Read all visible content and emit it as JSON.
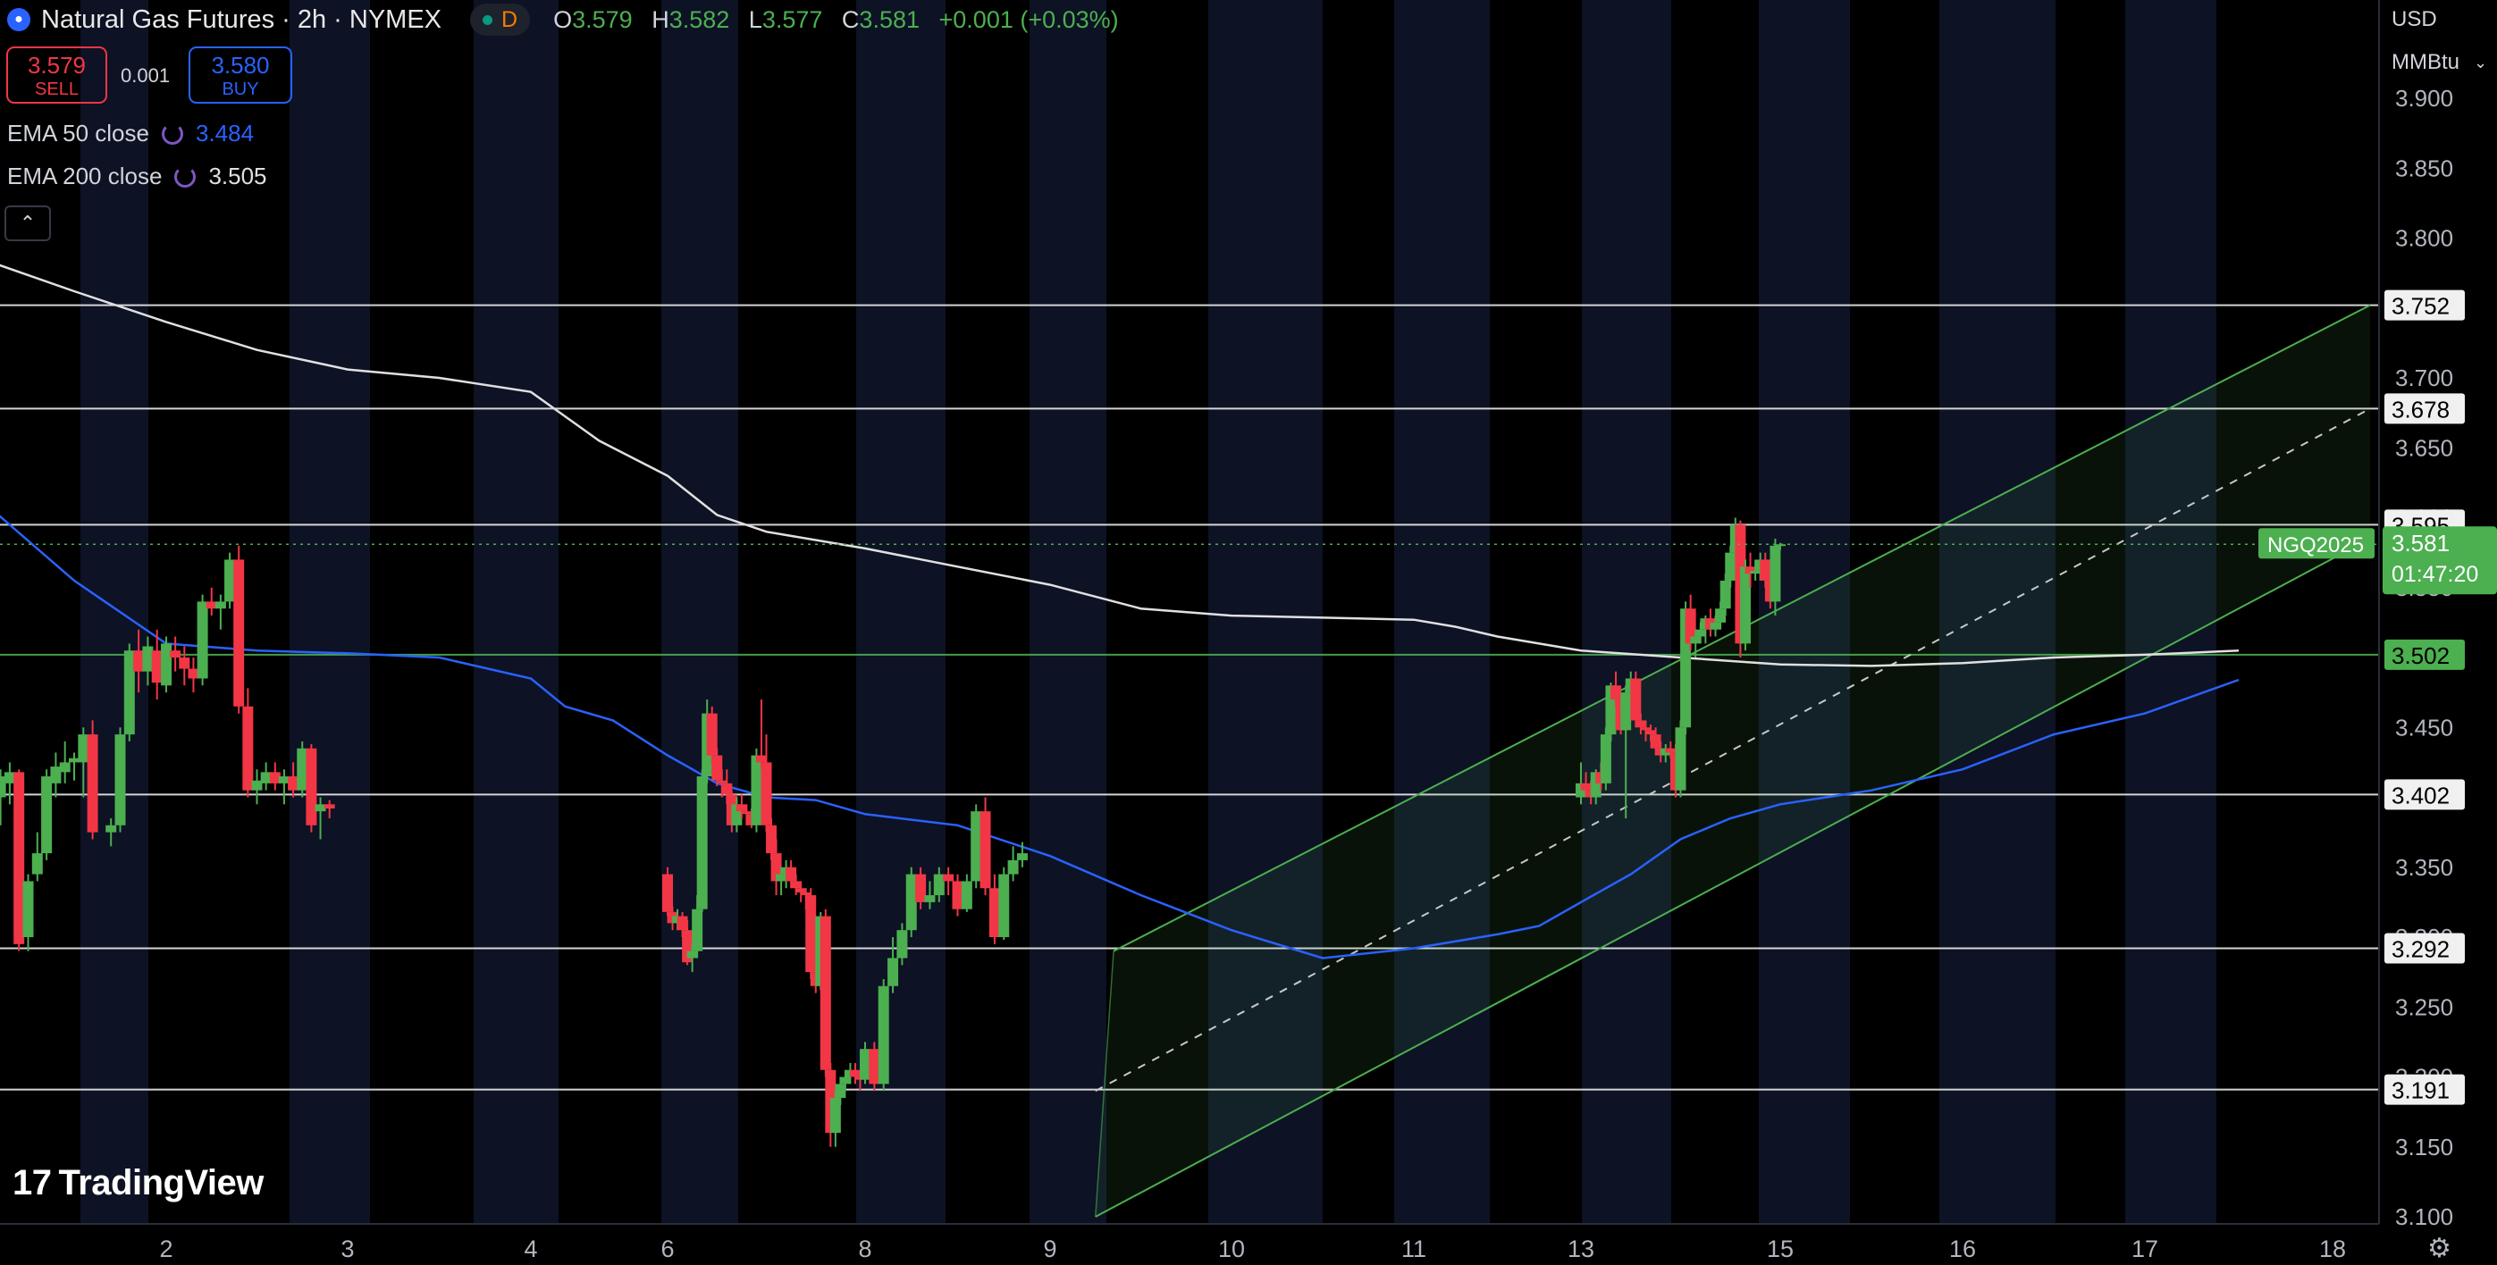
{
  "header": {
    "title": "Natural Gas Futures · 2h · NYMEX",
    "badge_letter": "D",
    "ohlc": {
      "o_label": "O",
      "o": "3.579",
      "h_label": "H",
      "h": "3.582",
      "l_label": "L",
      "l": "3.577",
      "c_label": "C",
      "c": "3.581",
      "change": "+0.001 (+0.03%)"
    }
  },
  "trade": {
    "sell_price": "3.579",
    "sell_label": "SELL",
    "spread": "0.001",
    "buy_price": "3.580",
    "buy_label": "BUY"
  },
  "indicators": [
    {
      "label": "EMA 50 close",
      "value": "3.484",
      "color": "#2962ff"
    },
    {
      "label": "EMA 200 close",
      "value": "3.505",
      "color": "#e0e0e0"
    }
  ],
  "price_axis": {
    "currency": "USD",
    "unit": "MMBtu",
    "ticks": [
      "3.900",
      "3.850",
      "3.800",
      "3.750",
      "3.700",
      "3.650",
      "3.600",
      "3.550",
      "3.500",
      "3.450",
      "3.400",
      "3.350",
      "3.300",
      "3.250",
      "3.200",
      "3.150",
      "3.100"
    ]
  },
  "time_axis": {
    "labels": [
      {
        "label": "2",
        "x": 2
      },
      {
        "label": "3",
        "x": 3
      },
      {
        "label": "4",
        "x": 4
      },
      {
        "label": "6",
        "x": 6
      },
      {
        "label": "8",
        "x": 8
      },
      {
        "label": "9",
        "x": 9
      },
      {
        "label": "10",
        "x": 10
      },
      {
        "label": "11",
        "x": 11
      },
      {
        "label": "13",
        "x": 13
      },
      {
        "label": "15",
        "x": 15
      },
      {
        "label": "16",
        "x": 16
      },
      {
        "label": "17",
        "x": 17
      },
      {
        "label": "18",
        "x": 18
      }
    ]
  },
  "current_price": {
    "symbol": "NGQ2025",
    "price": "3.581",
    "countdown": "01:47:20"
  },
  "brand": {
    "logo_text": "TradingView"
  },
  "colors": {
    "up": "#4caf50",
    "down": "#f23645",
    "ema50": "#2962ff",
    "ema200": "#e0e0e0",
    "channel": "#4caf50",
    "level": "#e0e0e0"
  },
  "chart_data": {
    "type": "candlestick",
    "ylim": [
      3.1,
      3.9
    ],
    "horizontal_levels": [
      {
        "value": 3.752,
        "label": "3.752"
      },
      {
        "value": 3.678,
        "label": "3.678"
      },
      {
        "value": 3.595,
        "label": "3.595"
      },
      {
        "value": 3.502,
        "label": "3.502",
        "highlight": true
      },
      {
        "value": 3.402,
        "label": "3.402"
      },
      {
        "value": 3.292,
        "label": "3.292"
      },
      {
        "value": 3.191,
        "label": "3.191"
      }
    ],
    "channel": {
      "upper": [
        [
          9.35,
          3.29
        ],
        [
          18.2,
          3.752
        ]
      ],
      "middle": [
        [
          9.25,
          3.19
        ],
        [
          18.2,
          3.678
        ]
      ],
      "lower": [
        [
          9.25,
          3.1
        ],
        [
          18.2,
          3.585
        ]
      ]
    },
    "ema50": [
      [
        1.0,
        3.612
      ],
      [
        1.5,
        3.555
      ],
      [
        2.0,
        3.51
      ],
      [
        2.5,
        3.505
      ],
      [
        3.0,
        3.503
      ],
      [
        3.5,
        3.5
      ],
      [
        4.0,
        3.485
      ],
      [
        4.5,
        3.465
      ],
      [
        5.2,
        3.455
      ],
      [
        6.0,
        3.43
      ],
      [
        6.5,
        3.41
      ],
      [
        7.0,
        3.4
      ],
      [
        7.5,
        3.398
      ],
      [
        8.0,
        3.388
      ],
      [
        8.5,
        3.38
      ],
      [
        9.0,
        3.358
      ],
      [
        9.5,
        3.33
      ],
      [
        10.0,
        3.305
      ],
      [
        10.5,
        3.285
      ],
      [
        11.0,
        3.292
      ],
      [
        12.0,
        3.302
      ],
      [
        12.5,
        3.308
      ],
      [
        13.0,
        3.325
      ],
      [
        13.5,
        3.345
      ],
      [
        14.0,
        3.37
      ],
      [
        14.5,
        3.385
      ],
      [
        15.0,
        3.395
      ],
      [
        15.5,
        3.405
      ],
      [
        16.0,
        3.42
      ],
      [
        16.5,
        3.445
      ],
      [
        17.0,
        3.46
      ],
      [
        17.5,
        3.484
      ]
    ],
    "ema200": [
      [
        1.0,
        3.785
      ],
      [
        1.5,
        3.762
      ],
      [
        2.0,
        3.74
      ],
      [
        2.5,
        3.72
      ],
      [
        3.0,
        3.706
      ],
      [
        3.5,
        3.7
      ],
      [
        4.0,
        3.69
      ],
      [
        5.0,
        3.655
      ],
      [
        6.0,
        3.63
      ],
      [
        6.5,
        3.602
      ],
      [
        7.0,
        3.59
      ],
      [
        8.0,
        3.578
      ],
      [
        8.5,
        3.565
      ],
      [
        9.0,
        3.552
      ],
      [
        9.5,
        3.535
      ],
      [
        10.0,
        3.53
      ],
      [
        11.0,
        3.527
      ],
      [
        11.5,
        3.522
      ],
      [
        12.0,
        3.515
      ],
      [
        12.5,
        3.51
      ],
      [
        13.0,
        3.505
      ],
      [
        14.0,
        3.5
      ],
      [
        15.0,
        3.495
      ],
      [
        15.5,
        3.494
      ],
      [
        16.0,
        3.496
      ],
      [
        16.5,
        3.5
      ],
      [
        17.0,
        3.502
      ],
      [
        17.5,
        3.505
      ]
    ],
    "candles": [
      [
        1.0,
        3.455,
        3.46,
        3.44,
        3.442
      ],
      [
        1.05,
        3.44,
        3.448,
        3.39,
        3.395
      ],
      [
        1.1,
        3.4,
        3.42,
        3.38,
        3.415
      ],
      [
        1.15,
        3.41,
        3.425,
        3.395,
        3.418
      ],
      [
        1.2,
        3.418,
        3.42,
        3.29,
        3.295
      ],
      [
        1.25,
        3.3,
        3.345,
        3.29,
        3.34
      ],
      [
        1.3,
        3.345,
        3.375,
        3.34,
        3.36
      ],
      [
        1.35,
        3.36,
        3.42,
        3.355,
        3.415
      ],
      [
        1.4,
        3.41,
        3.432,
        3.4,
        3.422
      ],
      [
        1.45,
        3.418,
        3.44,
        3.41,
        3.425
      ],
      [
        1.5,
        3.425,
        3.432,
        3.412,
        3.428
      ],
      [
        1.55,
        3.425,
        3.45,
        3.4,
        3.445
      ],
      [
        1.6,
        3.445,
        3.455,
        3.37,
        3.375
      ],
      [
        1.7,
        3.375,
        3.385,
        3.365,
        3.38
      ],
      [
        1.75,
        3.38,
        3.45,
        3.375,
        3.445
      ],
      [
        1.8,
        3.445,
        3.51,
        3.44,
        3.505
      ],
      [
        1.85,
        3.505,
        3.52,
        3.475,
        3.49
      ],
      [
        1.9,
        3.49,
        3.515,
        3.48,
        3.508
      ],
      [
        1.95,
        3.505,
        3.52,
        3.47,
        3.482
      ],
      [
        2.0,
        3.48,
        3.515,
        3.475,
        3.51
      ],
      [
        2.05,
        3.505,
        3.515,
        3.49,
        3.5
      ],
      [
        2.1,
        3.5,
        3.508,
        3.48,
        3.492
      ],
      [
        2.15,
        3.492,
        3.5,
        3.475,
        3.485
      ],
      [
        2.2,
        3.485,
        3.545,
        3.48,
        3.54
      ],
      [
        2.25,
        3.54,
        3.55,
        3.53,
        3.535
      ],
      [
        2.3,
        3.535,
        3.545,
        3.52,
        3.54
      ],
      [
        2.35,
        3.54,
        3.575,
        3.535,
        3.57
      ],
      [
        2.4,
        3.57,
        3.58,
        3.46,
        3.465
      ],
      [
        2.45,
        3.465,
        3.478,
        3.4,
        3.405
      ],
      [
        2.5,
        3.405,
        3.42,
        3.395,
        3.412
      ],
      [
        2.55,
        3.41,
        3.425,
        3.405,
        3.418
      ],
      [
        2.6,
        3.418,
        3.425,
        3.405,
        3.41
      ],
      [
        2.65,
        3.41,
        3.42,
        3.395,
        3.415
      ],
      [
        2.7,
        3.415,
        3.425,
        3.4,
        3.405
      ],
      [
        2.75,
        3.405,
        3.44,
        3.4,
        3.435
      ],
      [
        2.8,
        3.435,
        3.438,
        3.375,
        3.38
      ],
      [
        2.85,
        3.39,
        3.4,
        3.37,
        3.395
      ],
      [
        2.9,
        3.395,
        3.398,
        3.385,
        3.392
      ],
      [
        6.0,
        3.345,
        3.35,
        3.315,
        3.318
      ],
      [
        6.05,
        3.318,
        3.322,
        3.305,
        3.31
      ],
      [
        6.1,
        3.31,
        3.32,
        3.305,
        3.315
      ],
      [
        6.15,
        3.315,
        3.318,
        3.3,
        3.305
      ],
      [
        6.2,
        3.305,
        3.312,
        3.28,
        3.282
      ],
      [
        6.25,
        3.285,
        3.295,
        3.275,
        3.29
      ],
      [
        6.3,
        3.29,
        3.33,
        3.285,
        3.32
      ],
      [
        6.35,
        3.32,
        3.42,
        3.318,
        3.415
      ],
      [
        6.4,
        3.415,
        3.47,
        3.41,
        3.46
      ],
      [
        6.45,
        3.46,
        3.465,
        3.425,
        3.43
      ],
      [
        6.5,
        3.43,
        3.435,
        3.408,
        3.412
      ],
      [
        6.55,
        3.412,
        3.42,
        3.4,
        3.41
      ],
      [
        6.6,
        3.41,
        3.42,
        3.395,
        3.402
      ],
      [
        6.65,
        3.402,
        3.405,
        3.375,
        3.38
      ],
      [
        6.7,
        3.38,
        3.4,
        3.375,
        3.395
      ],
      [
        6.75,
        3.395,
        3.402,
        3.385,
        3.39
      ],
      [
        6.8,
        3.39,
        3.395,
        3.38,
        3.388
      ],
      [
        6.85,
        3.388,
        3.392,
        3.378,
        3.38
      ],
      [
        6.9,
        3.38,
        3.435,
        3.375,
        3.43
      ],
      [
        6.95,
        3.43,
        3.47,
        3.42,
        3.425
      ],
      [
        7.0,
        3.425,
        3.445,
        3.375,
        3.38
      ],
      [
        7.05,
        3.38,
        3.385,
        3.355,
        3.36
      ],
      [
        7.1,
        3.36,
        3.37,
        3.33,
        3.34
      ],
      [
        7.15,
        3.34,
        3.35,
        3.33,
        3.345
      ],
      [
        7.2,
        3.345,
        3.355,
        3.335,
        3.35
      ],
      [
        7.25,
        3.35,
        3.355,
        3.335,
        3.34
      ],
      [
        7.3,
        3.34,
        3.345,
        3.33,
        3.335
      ],
      [
        7.35,
        3.335,
        3.34,
        3.325,
        3.332
      ],
      [
        7.4,
        3.332,
        3.335,
        3.32,
        3.33
      ],
      [
        7.45,
        3.33,
        3.335,
        3.27,
        3.275
      ],
      [
        7.5,
        3.275,
        3.28,
        3.26,
        3.265
      ],
      [
        7.55,
        3.265,
        3.318,
        3.262,
        3.315
      ],
      [
        7.6,
        3.315,
        3.32,
        3.2,
        3.205
      ],
      [
        7.65,
        3.205,
        3.21,
        3.15,
        3.16
      ],
      [
        7.7,
        3.16,
        3.19,
        3.15,
        3.185
      ],
      [
        7.75,
        3.185,
        3.2,
        3.18,
        3.195
      ],
      [
        7.8,
        3.195,
        3.205,
        3.19,
        3.2
      ],
      [
        7.85,
        3.2,
        3.21,
        3.195,
        3.205
      ],
      [
        7.9,
        3.205,
        3.21,
        3.195,
        3.2
      ],
      [
        7.95,
        3.2,
        3.205,
        3.19,
        3.198
      ],
      [
        8.0,
        3.198,
        3.225,
        3.195,
        3.22
      ],
      [
        8.05,
        3.22,
        3.225,
        3.19,
        3.195
      ],
      [
        8.1,
        3.195,
        3.27,
        3.19,
        3.265
      ],
      [
        8.15,
        3.265,
        3.3,
        3.26,
        3.285
      ],
      [
        8.2,
        3.285,
        3.31,
        3.28,
        3.305
      ],
      [
        8.25,
        3.305,
        3.35,
        3.3,
        3.345
      ],
      [
        8.3,
        3.345,
        3.35,
        3.32,
        3.325
      ],
      [
        8.35,
        3.325,
        3.34,
        3.32,
        3.33
      ],
      [
        8.4,
        3.33,
        3.35,
        3.325,
        3.345
      ],
      [
        8.45,
        3.345,
        3.35,
        3.33,
        3.34
      ],
      [
        8.5,
        3.34,
        3.345,
        3.315,
        3.32
      ],
      [
        8.55,
        3.32,
        3.345,
        3.318,
        3.34
      ],
      [
        8.6,
        3.34,
        3.395,
        3.335,
        3.39
      ],
      [
        8.65,
        3.39,
        3.4,
        3.33,
        3.335
      ],
      [
        8.7,
        3.335,
        3.345,
        3.295,
        3.3
      ],
      [
        8.75,
        3.3,
        3.35,
        3.298,
        3.345
      ],
      [
        8.8,
        3.345,
        3.365,
        3.34,
        3.355
      ],
      [
        8.85,
        3.355,
        3.368,
        3.35,
        3.36
      ],
      [
        13.0,
        3.4,
        3.425,
        3.395,
        3.41
      ],
      [
        13.05,
        3.41,
        3.418,
        3.4,
        3.405
      ],
      [
        13.1,
        3.405,
        3.412,
        3.395,
        3.4
      ],
      [
        13.15,
        3.4,
        3.42,
        3.395,
        3.418
      ],
      [
        13.2,
        3.418,
        3.425,
        3.405,
        3.41
      ],
      [
        13.25,
        3.41,
        3.45,
        3.405,
        3.445
      ],
      [
        13.3,
        3.445,
        3.482,
        3.44,
        3.48
      ],
      [
        13.35,
        3.48,
        3.49,
        3.465,
        3.47
      ],
      [
        13.4,
        3.47,
        3.475,
        3.445,
        3.448
      ],
      [
        13.45,
        3.448,
        3.48,
        3.385,
        3.475
      ],
      [
        13.5,
        3.475,
        3.49,
        3.47,
        3.485
      ],
      [
        13.55,
        3.485,
        3.49,
        3.45,
        3.455
      ],
      [
        13.6,
        3.455,
        3.46,
        3.445,
        3.45
      ],
      [
        13.65,
        3.45,
        3.455,
        3.44,
        3.448
      ],
      [
        13.7,
        3.448,
        3.452,
        3.44,
        3.445
      ],
      [
        13.75,
        3.445,
        3.45,
        3.43,
        3.435
      ],
      [
        13.8,
        3.435,
        3.44,
        3.425,
        3.43
      ],
      [
        13.85,
        3.43,
        3.438,
        3.425,
        3.435
      ],
      [
        13.9,
        3.435,
        3.44,
        3.428,
        3.432
      ],
      [
        13.95,
        3.432,
        3.438,
        3.4,
        3.405
      ],
      [
        14.0,
        3.405,
        3.455,
        3.4,
        3.45
      ],
      [
        14.05,
        3.45,
        3.54,
        3.445,
        3.535
      ],
      [
        14.1,
        3.535,
        3.545,
        3.505,
        3.51
      ],
      [
        14.15,
        3.51,
        3.52,
        3.5,
        3.515
      ],
      [
        14.2,
        3.515,
        3.525,
        3.51,
        3.52
      ],
      [
        14.25,
        3.52,
        3.53,
        3.51,
        3.528
      ],
      [
        14.3,
        3.528,
        3.535,
        3.515,
        3.52
      ],
      [
        14.35,
        3.52,
        3.53,
        3.515,
        3.525
      ],
      [
        14.4,
        3.525,
        3.54,
        3.52,
        3.535
      ],
      [
        14.45,
        3.535,
        3.56,
        3.53,
        3.555
      ],
      [
        14.5,
        3.555,
        3.58,
        3.55,
        3.575
      ],
      [
        14.55,
        3.575,
        3.6,
        3.57,
        3.595
      ],
      [
        14.6,
        3.595,
        3.598,
        3.5,
        3.51
      ],
      [
        14.65,
        3.51,
        3.57,
        3.505,
        3.565
      ],
      [
        14.7,
        3.565,
        3.575,
        3.55,
        3.56
      ],
      [
        14.75,
        3.56,
        3.57,
        3.555,
        3.562
      ],
      [
        14.8,
        3.562,
        3.575,
        3.555,
        3.57
      ],
      [
        14.85,
        3.57,
        3.575,
        3.55,
        3.555
      ],
      [
        14.9,
        3.555,
        3.56,
        3.535,
        3.54
      ],
      [
        14.95,
        3.54,
        3.585,
        3.53,
        3.58
      ],
      [
        15.0,
        3.58,
        3.582,
        3.577,
        3.581
      ]
    ]
  }
}
